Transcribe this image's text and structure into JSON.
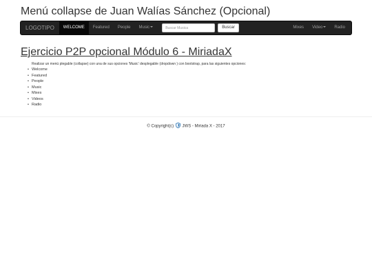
{
  "page": {
    "title": "Menú collapse de Juan Walías Sánchez (Opcional)"
  },
  "navbar": {
    "brand": "LOGOTIPO",
    "items": [
      {
        "label": "WELCOME",
        "active": true
      },
      {
        "label": "Featured"
      },
      {
        "label": "People"
      },
      {
        "label": "Music",
        "dropdown": true
      }
    ],
    "search": {
      "placeholder": "Buscar Musica",
      "value": "",
      "button_label": "Buscar"
    },
    "right_items": [
      {
        "label": "Mixes"
      },
      {
        "label": "Video",
        "dropdown": true
      },
      {
        "label": "Radio"
      }
    ]
  },
  "main": {
    "heading": "Ejercicio P2P opcional Módulo 6 - MiriadaX",
    "intro": "Realizar un menú plegable (collapse) con una de sus opciones 'Music' desplegable (dropdown ) con bootstrap, para las siguientes opciones:",
    "options": [
      "Welcome",
      "Featured",
      "People",
      "Music",
      "Mixes",
      "Videos",
      "Radio"
    ]
  },
  "footer": {
    "copyright": "© Copyright(c)",
    "icon": "shield-icon",
    "text": "JWS - Miriada X - 2017"
  },
  "colors": {
    "navbar_bg": "#222222",
    "navbar_active_bg": "#080808",
    "navbar_text": "#9d9d9d",
    "accent_icon": "#337ab7"
  }
}
